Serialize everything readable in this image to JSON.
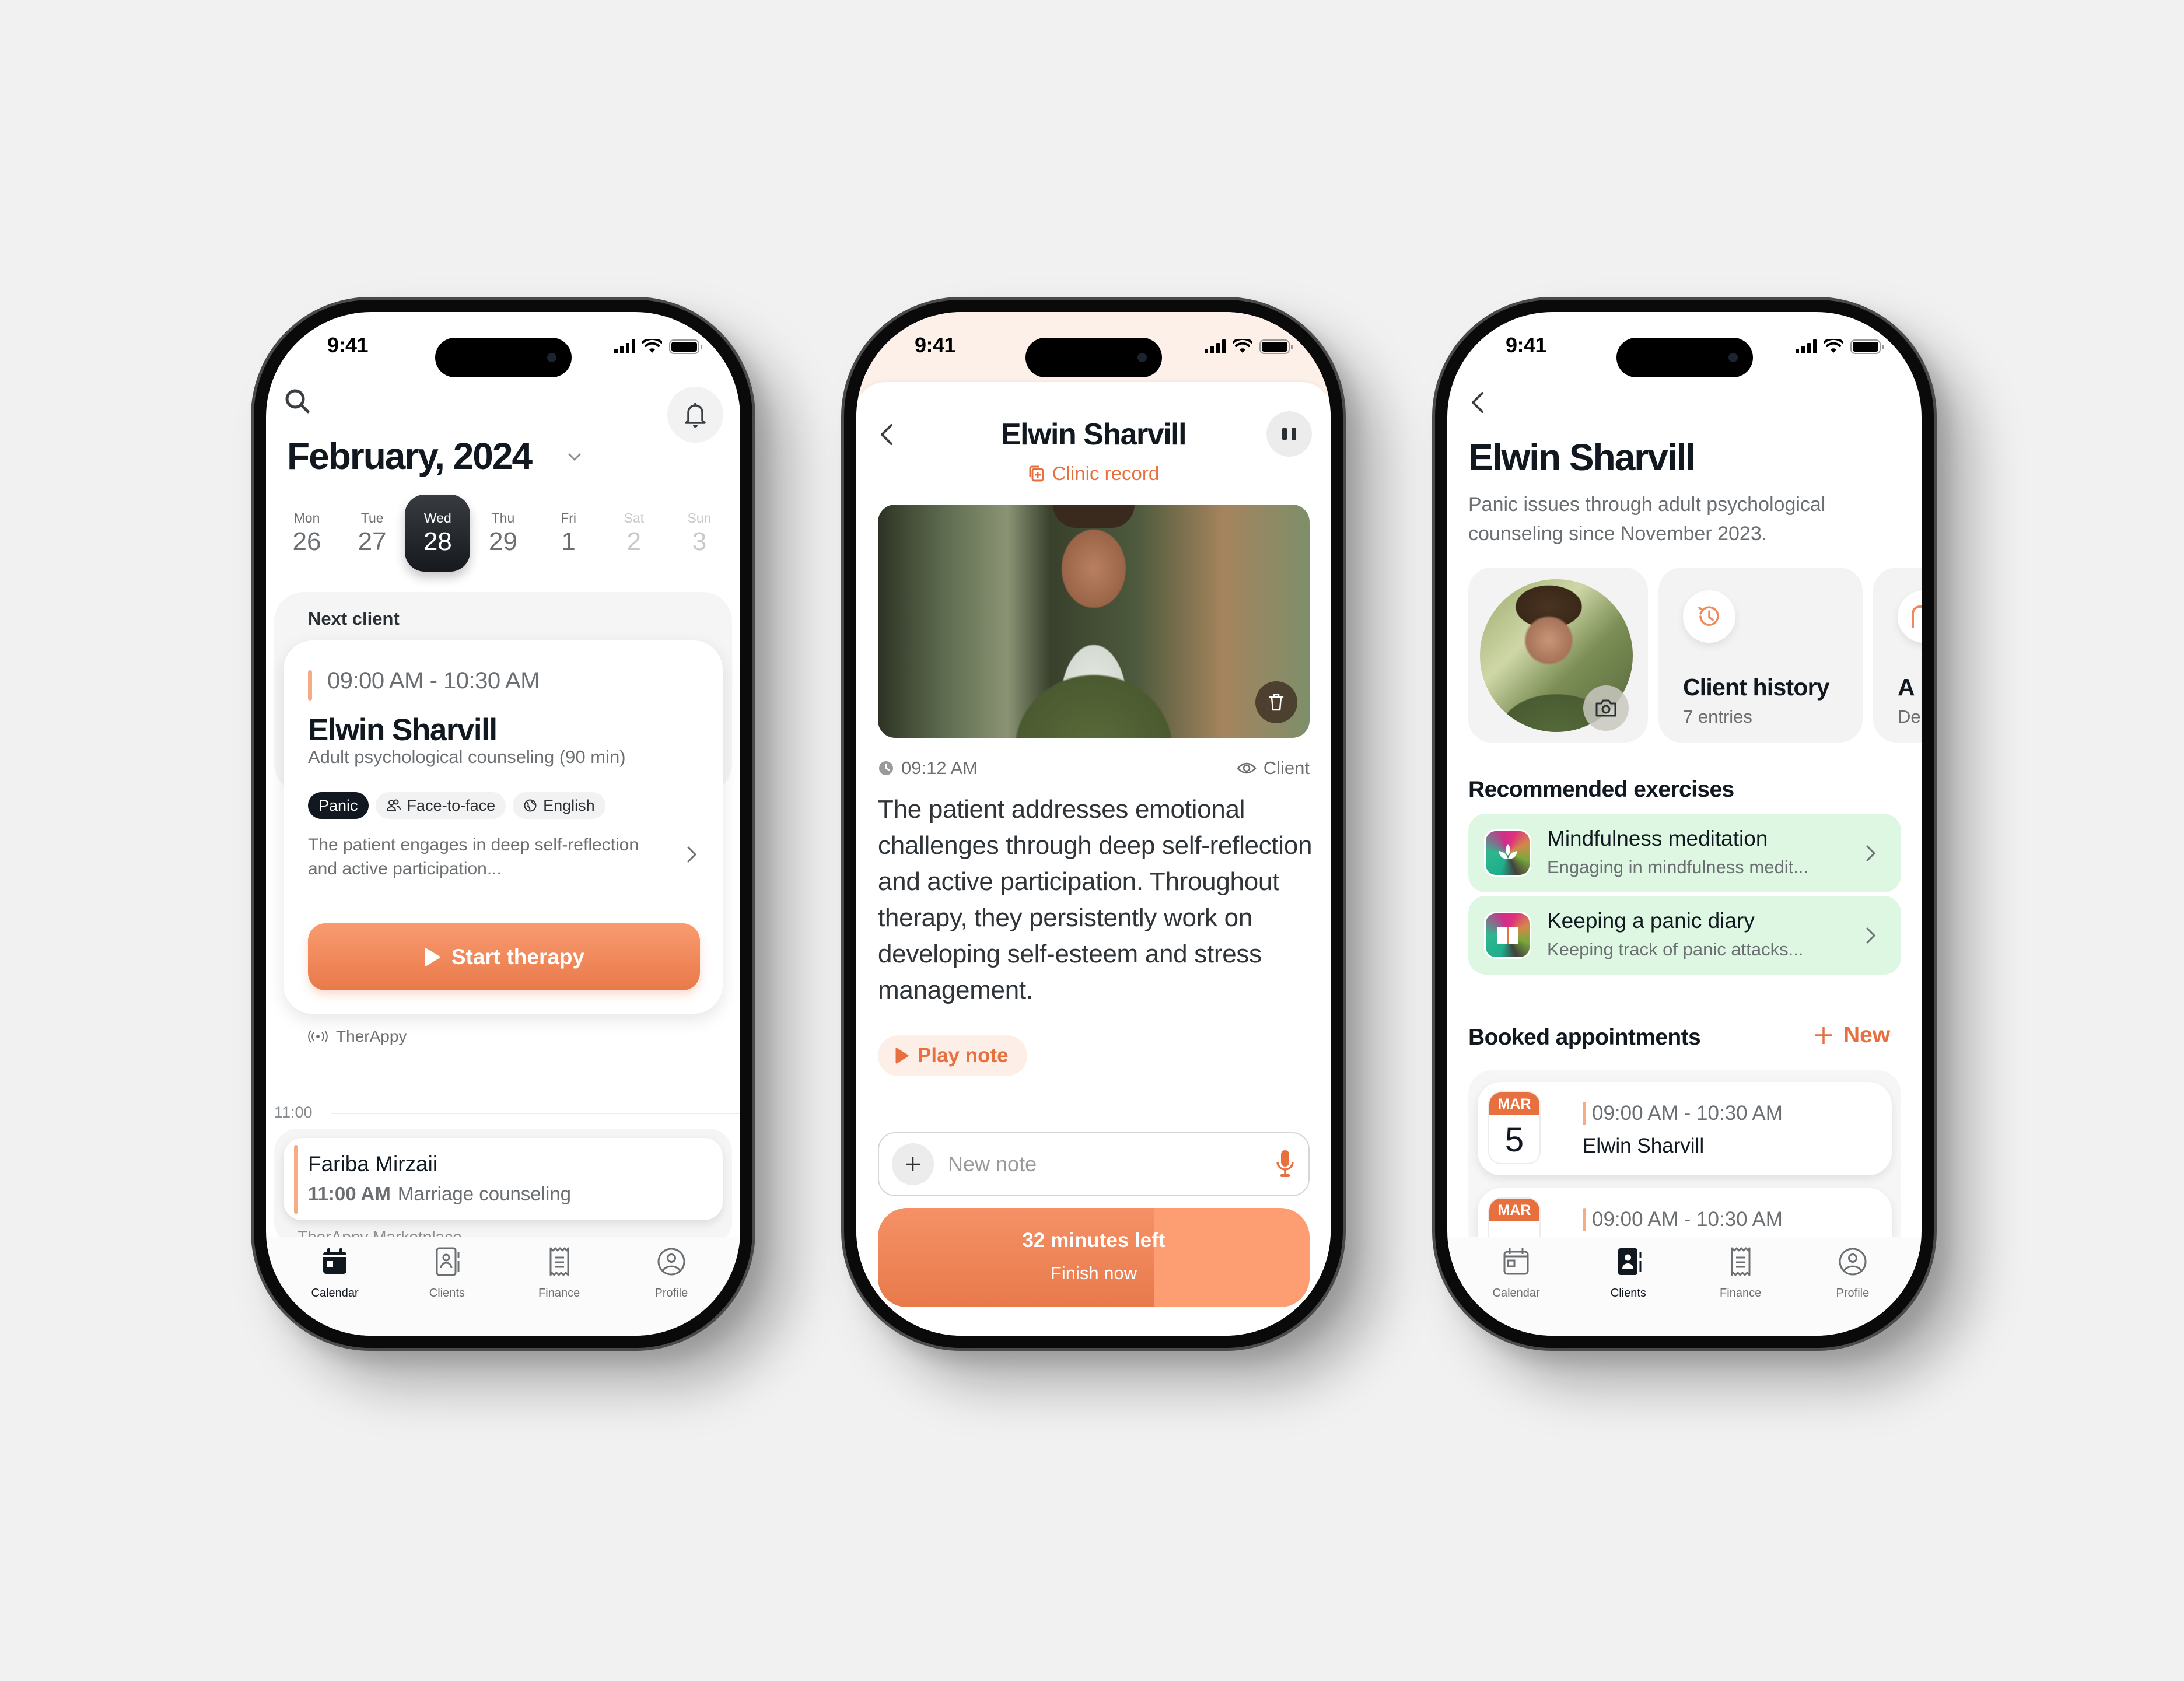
{
  "status_bar": {
    "time": "9:41"
  },
  "phone_calendar": {
    "title": "February, 2024",
    "days": [
      {
        "name": "Mon",
        "num": "26",
        "state": "normal"
      },
      {
        "name": "Tue",
        "num": "27",
        "state": "normal"
      },
      {
        "name": "Wed",
        "num": "28",
        "state": "selected"
      },
      {
        "name": "Thu",
        "num": "29",
        "state": "normal"
      },
      {
        "name": "Fri",
        "num": "1",
        "state": "normal"
      },
      {
        "name": "Sat",
        "num": "2",
        "state": "muted"
      },
      {
        "name": "Sun",
        "num": "3",
        "state": "muted"
      }
    ],
    "next_client_label": "Next client",
    "next_client": {
      "time": "09:00 AM - 10:30 AM",
      "name": "Elwin Sharvill",
      "service": "Adult psychological counseling (90 min)",
      "tags": [
        "Panic",
        "Face-to-face",
        "English"
      ],
      "description": "The patient engages in deep self-reflection and active participation...",
      "start_button": "Start therapy",
      "source": "TherAppy"
    },
    "hour_label": "11:00",
    "appointment": {
      "name": "Fariba Mirzaii",
      "time": "11:00 AM",
      "service": "Marriage counseling",
      "source": "TherAppy Marketplace"
    }
  },
  "phone_session": {
    "title": "Elwin Sharvill",
    "clinic_record_link": "Clinic record",
    "note_time": "09:12 AM",
    "note_visibility": "Client",
    "note_text": "The patient addresses emotional challenges through deep self-reflection and active participation. Throughout therapy, they persistently work on developing self-esteem and stress management.",
    "play_note": "Play note",
    "new_note_placeholder": "New note",
    "new_note_value": "",
    "session_progress_fraction": 0.64,
    "time_left": "32 minutes left",
    "finish_button": "Finish now"
  },
  "phone_client": {
    "title": "Elwin Sharvill",
    "description": "Panic issues through adult psychological counseling since November 2023.",
    "history_card": {
      "title": "Client history",
      "sub": "7 entries"
    },
    "third_card": {
      "title": "A",
      "sub": "De"
    },
    "recommended_heading": "Recommended exercises",
    "exercises": [
      {
        "title": "Mindfulness meditation",
        "sub": "Engaging in mindfulness medit..."
      },
      {
        "title": "Keeping a panic diary",
        "sub": "Keeping track of panic attacks..."
      }
    ],
    "booked_heading": "Booked appointments",
    "new_button": "New",
    "bookings": [
      {
        "month": "MAR",
        "day": "5",
        "time": "09:00 AM - 10:30 AM",
        "name": "Elwin Sharvill"
      },
      {
        "month": "MAR",
        "day": "",
        "time": "09:00 AM - 10:30 AM",
        "name": ""
      }
    ]
  },
  "tabs": [
    "Calendar",
    "Clients",
    "Finance",
    "Profile"
  ],
  "colors": {
    "accent": "#e8703f",
    "accent_light": "#f3ac86",
    "dark": "#111820",
    "exercise_bg": "#ddf7e2"
  }
}
